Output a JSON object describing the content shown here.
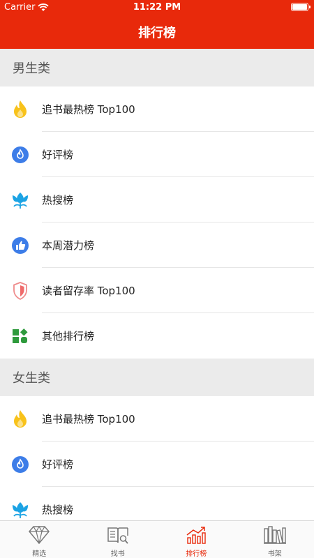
{
  "status_bar": {
    "carrier": "Carrier",
    "time": "11:22 PM"
  },
  "nav": {
    "title": "排行榜"
  },
  "sections": [
    {
      "header": "男生类",
      "items": [
        {
          "label": "追书最热榜 Top100",
          "icon": "flame-icon"
        },
        {
          "label": "好评榜",
          "icon": "thumbs-flame-icon"
        },
        {
          "label": "热搜榜",
          "icon": "lotus-icon"
        },
        {
          "label": "本周潜力榜",
          "icon": "thumbs-up-icon"
        },
        {
          "label": "读者留存率 Top100",
          "icon": "shield-icon"
        },
        {
          "label": "其他排行榜",
          "icon": "grid-icon"
        }
      ]
    },
    {
      "header": "女生类",
      "items": [
        {
          "label": "追书最热榜 Top100",
          "icon": "flame-icon"
        },
        {
          "label": "好评榜",
          "icon": "thumbs-flame-icon"
        },
        {
          "label": "热搜榜",
          "icon": "lotus-icon"
        }
      ]
    }
  ],
  "tabs": [
    {
      "label": "精选",
      "icon": "diamond-icon",
      "active": false
    },
    {
      "label": "找书",
      "icon": "book-search-icon",
      "active": false
    },
    {
      "label": "排行榜",
      "icon": "chart-up-icon",
      "active": true
    },
    {
      "label": "书架",
      "icon": "bookshelf-icon",
      "active": false
    }
  ],
  "colors": {
    "accent": "#e8290b",
    "section_bg": "#ebebeb"
  }
}
